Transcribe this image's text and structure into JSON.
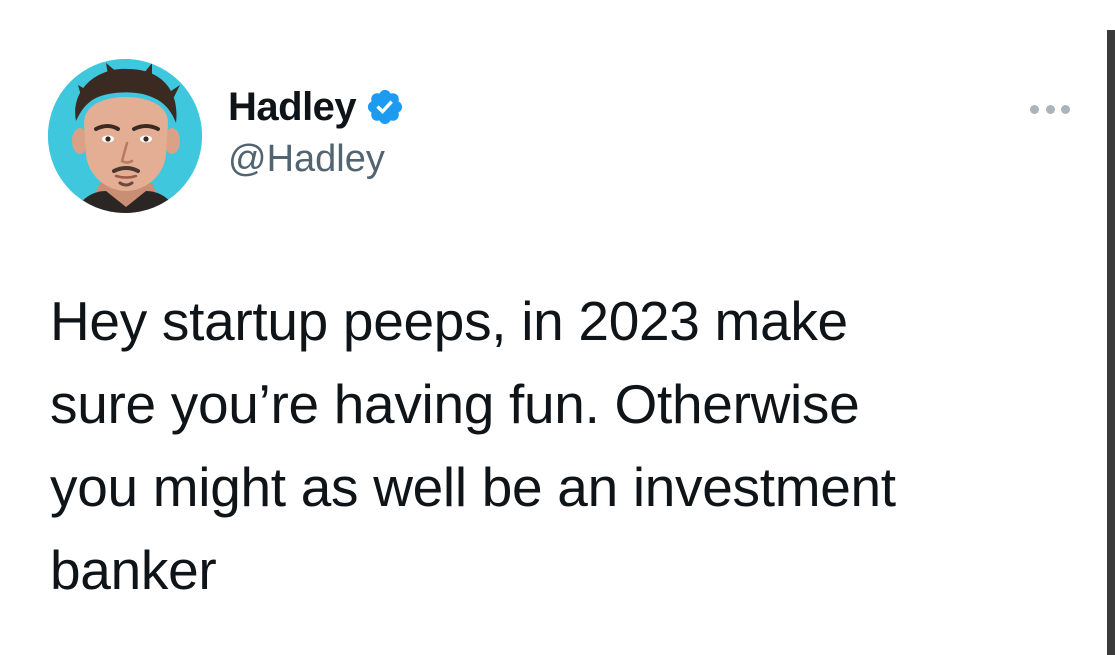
{
  "author": {
    "display_name": "Hadley",
    "handle": "@Hadley",
    "verified": true
  },
  "tweet": {
    "text": "Hey startup peeps, in 2023 make\nsure you’re having fun. Otherwise\nyou might as well be an investment\nbanker"
  },
  "icons": {
    "verified": "verified-badge-icon",
    "more": "more-options-icon"
  },
  "colors": {
    "verified_blue": "#1d9bf0",
    "handle_gray": "#536471",
    "avatar_bg": "#3fc7de"
  }
}
